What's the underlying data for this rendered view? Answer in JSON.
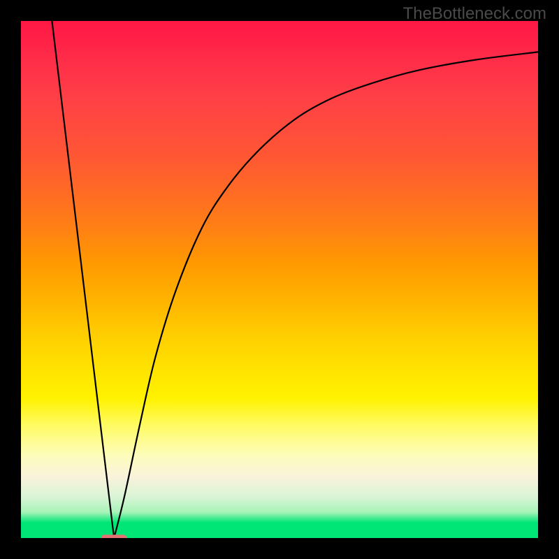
{
  "watermark": "TheBottleneck.com",
  "chart_data": {
    "type": "line",
    "title": "",
    "xlabel": "",
    "ylabel": "",
    "xlim": [
      0,
      100
    ],
    "ylim": [
      0,
      100
    ],
    "optimum_x": 18,
    "series": [
      {
        "name": "left-curve",
        "points": [
          {
            "x": 6,
            "y": 100
          },
          {
            "x": 18,
            "y": 0
          }
        ]
      },
      {
        "name": "right-curve",
        "points": [
          {
            "x": 18,
            "y": 0
          },
          {
            "x": 20,
            "y": 8
          },
          {
            "x": 23,
            "y": 22
          },
          {
            "x": 26,
            "y": 35
          },
          {
            "x": 30,
            "y": 48
          },
          {
            "x": 35,
            "y": 60
          },
          {
            "x": 40,
            "y": 68
          },
          {
            "x": 46,
            "y": 75
          },
          {
            "x": 53,
            "y": 81
          },
          {
            "x": 60,
            "y": 85
          },
          {
            "x": 68,
            "y": 88
          },
          {
            "x": 77,
            "y": 90.5
          },
          {
            "x": 88,
            "y": 92.5
          },
          {
            "x": 100,
            "y": 94
          }
        ]
      }
    ],
    "marker": {
      "x": 18,
      "y": 0,
      "width_pct": 5,
      "height_pct": 1.3
    }
  },
  "colors": {
    "curve": "#000000",
    "marker": "#e57373"
  }
}
